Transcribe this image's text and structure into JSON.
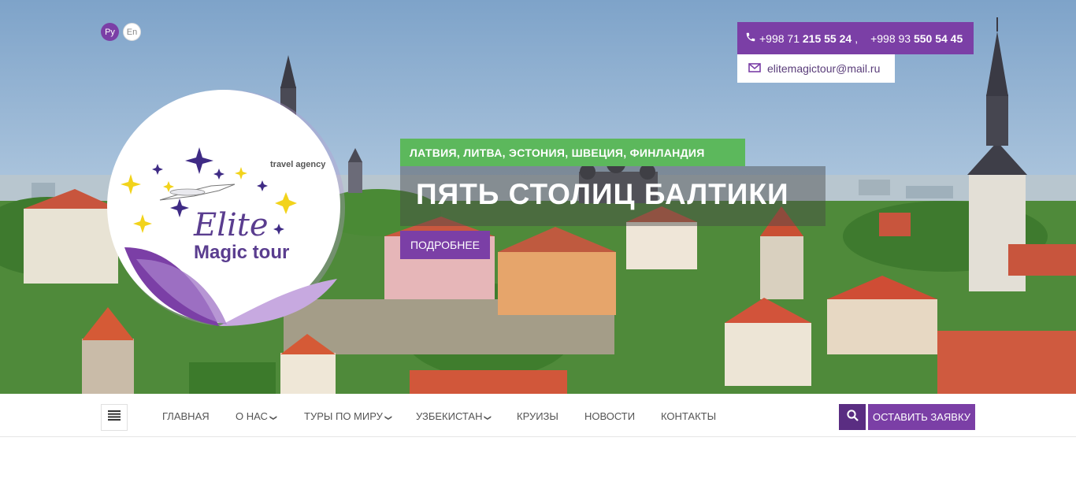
{
  "language": {
    "ru": "Ру",
    "en": "En"
  },
  "contacts": {
    "phone1_prefix": "+998 71 ",
    "phone1_main": "215 55 24",
    "separator": " ,",
    "phone2_prefix": "+998 93 ",
    "phone2_main": "550 54 45",
    "email": "elitemagictour@mail.ru"
  },
  "logo": {
    "tagline": "travel agency",
    "brand_script": "Elite",
    "brand_name": "Magic tour"
  },
  "slide": {
    "tag": "ЛАТВИЯ, ЛИТВА, ЭСТОНИЯ, ШВЕЦИЯ, ФИНЛАНДИЯ",
    "headline": "ПЯТЬ СТОЛИЦ БАЛТИКИ",
    "more_label": "ПОДРОБНЕЕ"
  },
  "nav": {
    "items": [
      {
        "label": "ГЛАВНАЯ"
      },
      {
        "label": "О НАС"
      },
      {
        "label": "ТУРЫ ПО МИРУ"
      },
      {
        "label": "УЗБЕКИСТАН"
      },
      {
        "label": "КРУИЗЫ"
      },
      {
        "label": "НОВОСТИ"
      },
      {
        "label": "КОНТАКТЫ"
      }
    ],
    "request_label": "ОСТАВИТЬ ЗАЯВКУ"
  },
  "colors": {
    "brand_purple": "#7b3fa6",
    "dark_purple": "#5a2d82",
    "green_tag": "#5cb85c",
    "star_yellow": "#f2d31b"
  }
}
